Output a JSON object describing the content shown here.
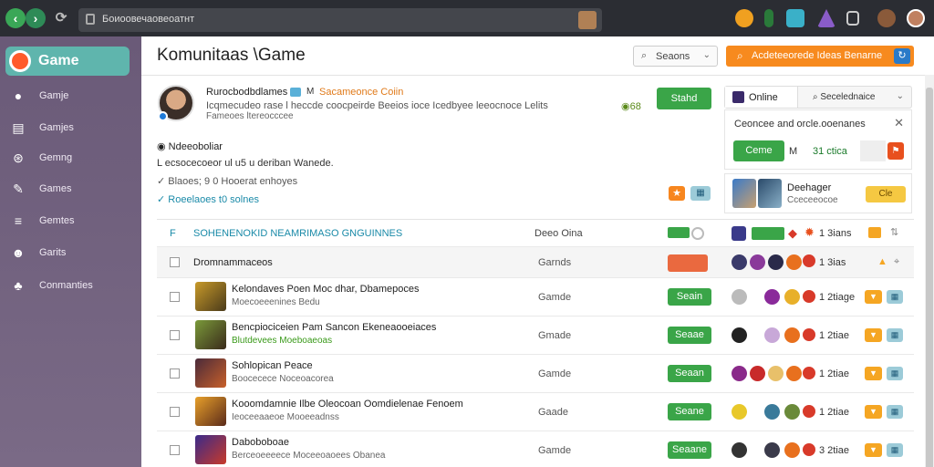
{
  "browser": {
    "url": "Боиоовечаовеоатнт"
  },
  "sidebar": {
    "brand": "Game",
    "items": [
      {
        "label": "Gamje",
        "icon": "circle-dot-icon"
      },
      {
        "label": "Gamjes",
        "icon": "document-icon"
      },
      {
        "label": "Gemng",
        "icon": "gamepad-icon"
      },
      {
        "label": "Games",
        "icon": "brush-icon"
      },
      {
        "label": "Gemtes",
        "icon": "menu-lines-icon"
      },
      {
        "label": "Garits",
        "icon": "character-icon"
      },
      {
        "label": "Conmanties",
        "icon": "community-icon"
      }
    ]
  },
  "header": {
    "title": "Komunitaas \\Game",
    "search_label": "Seaons",
    "cta_label": "Acdeteeorede Ideas Benarne"
  },
  "profile": {
    "name": "Rurocbodbdlames",
    "tag": "M",
    "role": "Sacameonce Coiin",
    "description": "Icqmecudeo rase l heccde coocpeirde Beeios ioce Icedbyee leeocnoce Lelits",
    "sub": "Fameoes ltereocccee",
    "count": "68",
    "follow_label": "Stahd"
  },
  "section": {
    "title": "Ndeeoboliar",
    "description": "L ecsocecoeor ul u5 u deriban Wanede.",
    "meta": "Blaoes; 9 0 Hooerat enhoyes",
    "link": "Roeelaoes t0 solnes"
  },
  "right_panel": {
    "online_tab": "Online",
    "selector": "Secelednaice",
    "card_title": "Ceoncee and orcle.ooenanes",
    "card_button": "Ceme",
    "card_value1": "M",
    "card_value2": "31 ctica",
    "feature_title": "Deehager",
    "feature_sub": "Cceceeocoe",
    "feature_button": "Cle"
  },
  "table": {
    "filter": "F",
    "header_label": "SOHENENOKID NEAMRIMASO GNGUINNES",
    "header_col": "Deeo Oina",
    "rows": [
      {
        "title": "Dromnammaceos",
        "sub": "",
        "col": "Garnds",
        "button": "",
        "value": "1 3ias",
        "alt": true,
        "thumb": ""
      },
      {
        "title": "Kelondaves Poen Moc dhar, Dbamepoces",
        "sub": "Moecoeeenines Bedu",
        "col": "Gamde",
        "button": "Seain",
        "value": "1 2tiage",
        "alt": false,
        "thumb": "#8a6a1a"
      },
      {
        "title": "Bencpiociceien Pam Sancon Ekeneaooeiaces",
        "sub": "Blutdevees Moeboaeoas",
        "col": "Gmade",
        "button": "Seaae",
        "value": "1 2tiae",
        "alt": false,
        "thumb": "#5a7a2a"
      },
      {
        "title": "Sohlopican Peace",
        "sub": "Boocecece Noceoacorea",
        "col": "Gamde",
        "button": "Seaan",
        "value": "1 2tiae",
        "alt": false,
        "thumb": "#4a2a3a"
      },
      {
        "title": "Kooomdamnie Ilbe Oleocoan Oomdielenae Fenoem",
        "sub": "Ieoceeaaeoe Mooeeadnss",
        "col": "Gaade",
        "button": "Seane",
        "value": "1 2tiae",
        "alt": false,
        "thumb": "#9a6a2a"
      },
      {
        "title": "Daboboboae",
        "sub": "Berceoeeeece Moceeoaoees Obanea",
        "col": "Gamde",
        "button": "Seaane",
        "value": "3 2tiae",
        "alt": false,
        "thumb": "#3a2a6a"
      }
    ]
  },
  "colors": {
    "accent_green": "#3aa548",
    "accent_orange": "#f78a1e",
    "sidebar": "#6a5a78",
    "link": "#1a8aa8"
  }
}
